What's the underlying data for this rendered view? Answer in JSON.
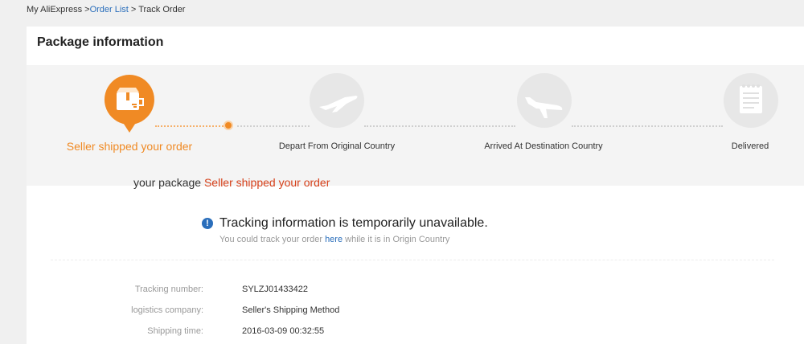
{
  "breadcrumb": {
    "root": "My AliExpress >",
    "order_list": "Order List",
    "sep": " > ",
    "current": "Track Order"
  },
  "panel": {
    "title": "Package information"
  },
  "steps": [
    {
      "label": "Seller shipped your order",
      "icon": "package-icon",
      "active": true
    },
    {
      "label": "Depart From Original Country",
      "icon": "plane-depart-icon",
      "active": false
    },
    {
      "label": "Arrived At Destination Country",
      "icon": "plane-arrive-icon",
      "active": false
    },
    {
      "label": "Delivered",
      "icon": "document-icon",
      "active": false
    }
  ],
  "status": {
    "prefix": "your package ",
    "value": "Seller shipped your order"
  },
  "notice": {
    "icon": "info-icon",
    "title": "Tracking information is temporarily unavailable.",
    "sub_prefix": "You could track your order ",
    "link": "here",
    "sub_suffix": " while it is in Origin Country"
  },
  "details": [
    {
      "label": "Tracking number:",
      "value": "SYLZJ01433422"
    },
    {
      "label": "logistics company:",
      "value": "Seller's Shipping Method"
    },
    {
      "label": "Shipping time:",
      "value": "2016-03-09 00:32:55"
    }
  ],
  "colors": {
    "accent": "#f08a24",
    "link": "#2a6ebb",
    "status_highlight": "#d6401a"
  }
}
